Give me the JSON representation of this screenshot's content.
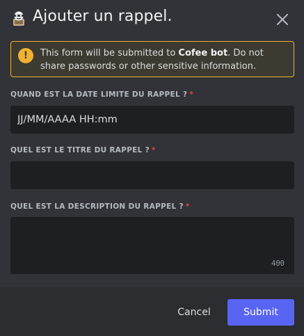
{
  "modal": {
    "title": "Ajouter un rappel.",
    "app_icon": "bot-mascot-icon",
    "close_icon": "close-icon"
  },
  "notice": {
    "icon": "warning-icon",
    "icon_glyph": "!",
    "text_before": "This form will be submitted to ",
    "bot_name": "Cofee bot",
    "text_after": ". Do not share passwords or other sensitive information."
  },
  "fields": {
    "due_date": {
      "label": "QUAND EST LA DATE LIMITE DU RAPPEL ?",
      "required_mark": "*",
      "placeholder": "JJ/MM/AAAA HH:mm",
      "value": ""
    },
    "title": {
      "label": "QUEL EST LE TITRE DU RAPPEL ?",
      "required_mark": "*",
      "value": ""
    },
    "description": {
      "label": "QUEL EST LA DESCRIPTION DU RAPPEL ?",
      "required_mark": "*",
      "value": "",
      "char_counter": "400"
    }
  },
  "footer": {
    "cancel_label": "Cancel",
    "submit_label": "Submit"
  },
  "colors": {
    "background": "#313338",
    "footer": "#2b2d31",
    "input": "#1e1f22",
    "warning": "#f0b232",
    "required": "#f23f43",
    "brand": "#5865f2"
  }
}
